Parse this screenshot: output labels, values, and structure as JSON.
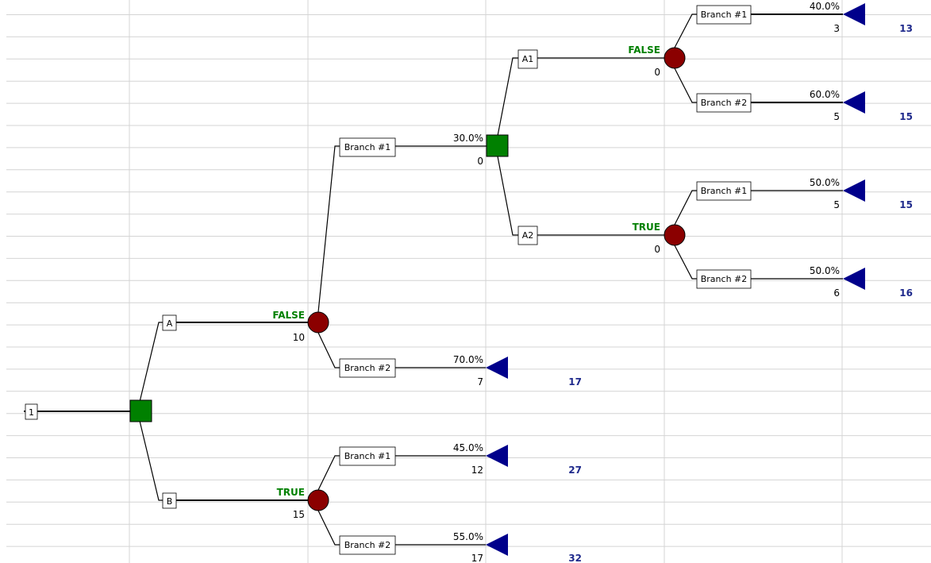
{
  "colors": {
    "grid": "#d4d4d4",
    "chance_node": "#8b0000",
    "decision_node": "#008000",
    "end_node": "#00008b",
    "true_false_label": "#008000",
    "payoff_value": "#1f2a8c",
    "text": "#000000",
    "line": "#000000"
  },
  "tree": {
    "root_label": "1",
    "branches": [
      {
        "id": "A",
        "label": "A"
      },
      {
        "id": "B",
        "label": "B"
      },
      {
        "id": "A-branch1",
        "label": "Branch #1",
        "probability": "30.0%",
        "value": "0"
      },
      {
        "id": "A-branch2",
        "label": "Branch #2",
        "probability": "70.0%",
        "value": "7"
      },
      {
        "id": "B-branch1",
        "label": "Branch #1",
        "probability": "45.0%",
        "value": "12"
      },
      {
        "id": "B-branch2",
        "label": "Branch #2",
        "probability": "55.0%",
        "value": "17"
      },
      {
        "id": "A1",
        "label": "A1"
      },
      {
        "id": "A2",
        "label": "A2"
      },
      {
        "id": "A1-branch1",
        "label": "Branch #1",
        "probability": "40.0%",
        "value": "3"
      },
      {
        "id": "A1-branch2",
        "label": "Branch #2",
        "probability": "60.0%",
        "value": "5"
      },
      {
        "id": "A2-branch1",
        "label": "Branch #1",
        "probability": "50.0%",
        "value": "5"
      },
      {
        "id": "A2-branch2",
        "label": "Branch #2",
        "probability": "50.0%",
        "value": "6"
      }
    ],
    "node_labels": [
      {
        "id": "chance-A",
        "status": "FALSE",
        "value": "10"
      },
      {
        "id": "chance-B",
        "status": "TRUE",
        "value": "15"
      },
      {
        "id": "chance-A1",
        "status": "FALSE",
        "value": "0"
      },
      {
        "id": "chance-A2",
        "status": "TRUE",
        "value": "0"
      }
    ],
    "payoffs": [
      {
        "id": "payoff-A1-b1",
        "value": "13"
      },
      {
        "id": "payoff-A1-b2",
        "value": "15"
      },
      {
        "id": "payoff-A2-b1",
        "value": "15"
      },
      {
        "id": "payoff-A2-b2",
        "value": "16"
      },
      {
        "id": "payoff-A-b2",
        "value": "17"
      },
      {
        "id": "payoff-B-b1",
        "value": "27"
      },
      {
        "id": "payoff-B-b2",
        "value": "32"
      }
    ]
  }
}
